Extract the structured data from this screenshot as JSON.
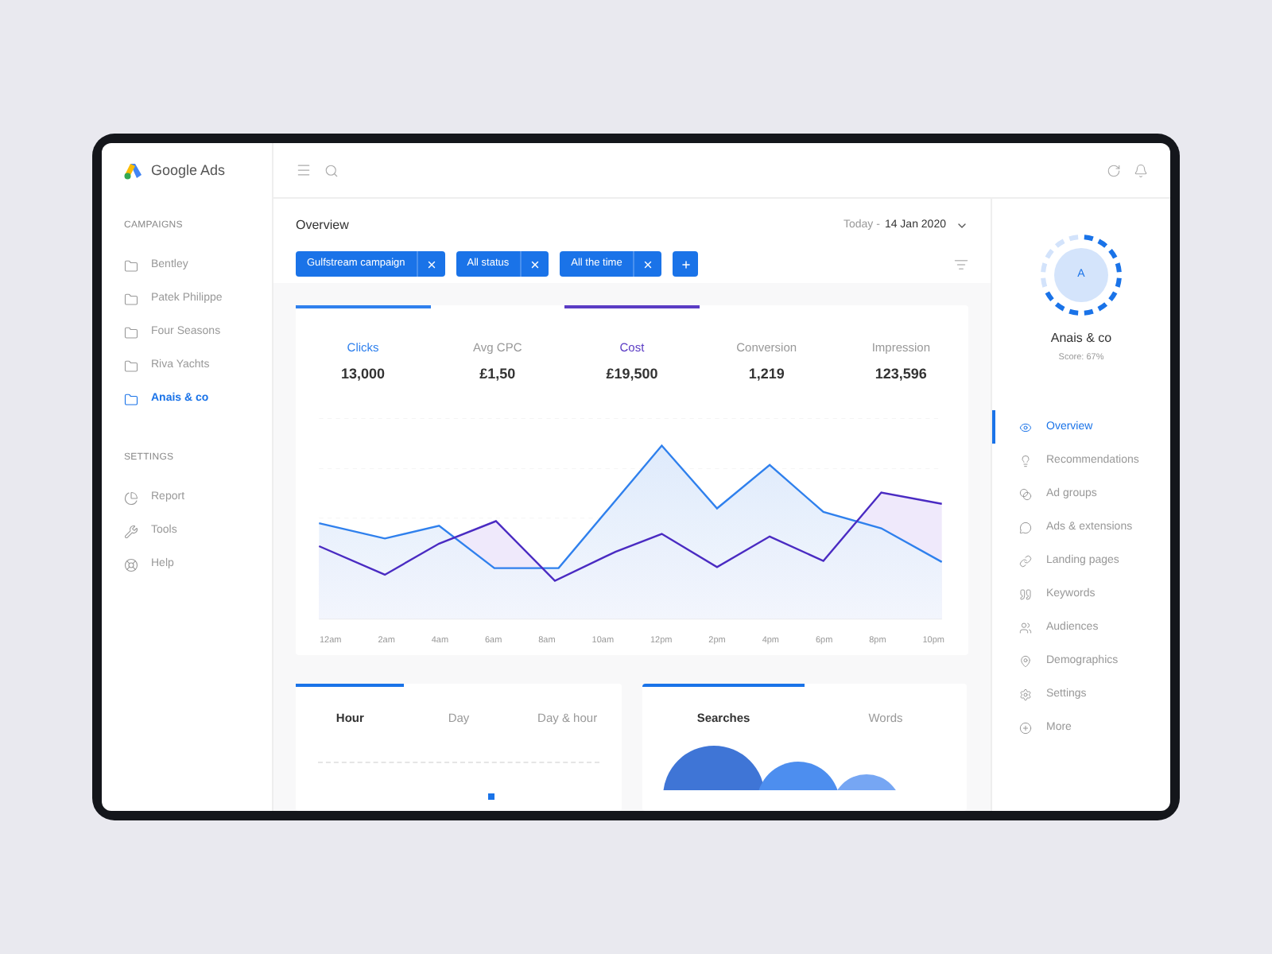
{
  "app": {
    "name": "Google Ads"
  },
  "sidebar": {
    "sections": [
      {
        "title": "CAMPAIGNS",
        "items": [
          {
            "label": "Bentley",
            "selected": false
          },
          {
            "label": "Patek Philippe",
            "selected": false
          },
          {
            "label": "Four Seasons",
            "selected": false
          },
          {
            "label": "Riva Yachts",
            "selected": false
          },
          {
            "label": "Anais & co",
            "selected": true
          }
        ]
      },
      {
        "title": "SETTINGS",
        "items": [
          {
            "label": "Report",
            "selected": false
          },
          {
            "label": "Tools",
            "selected": false
          },
          {
            "label": "Help",
            "selected": false
          }
        ]
      }
    ]
  },
  "header": {
    "title": "Overview",
    "date_prefix": "Today -",
    "date": "14 Jan 2020"
  },
  "filters": [
    {
      "label": "Gulfstream campaign"
    },
    {
      "label": "All status"
    },
    {
      "label": "All the time"
    }
  ],
  "metrics": [
    {
      "label": "Clicks",
      "value": "13,000",
      "selected": true,
      "color": "#2f80ed"
    },
    {
      "label": "Avg CPC",
      "value": "£1,50",
      "selected": false
    },
    {
      "label": "Cost",
      "value": "£19,500",
      "selected": true,
      "color": "#5b3cc4"
    },
    {
      "label": "Conversion",
      "value": "1,219",
      "selected": false
    },
    {
      "label": "Impression",
      "value": "123,596",
      "selected": false
    }
  ],
  "x_labels": [
    "12am",
    "2am",
    "4am",
    "6am",
    "8am",
    "10am",
    "12pm",
    "2pm",
    "4pm",
    "6pm",
    "8pm",
    "10pm"
  ],
  "time_tabs": [
    {
      "label": "Hour",
      "selected": true
    },
    {
      "label": "Day",
      "selected": false
    },
    {
      "label": "Day & hour",
      "selected": false
    }
  ],
  "search_tabs": [
    {
      "label": "Searches",
      "selected": true
    },
    {
      "label": "Words",
      "selected": false
    }
  ],
  "profile": {
    "initial": "A",
    "name": "Anais & co",
    "score": "Score: 67%",
    "level": 0.67
  },
  "nav": [
    {
      "label": "Overview",
      "selected": true
    },
    {
      "label": "Recommendations",
      "selected": false
    },
    {
      "label": "Ad groups",
      "selected": false
    },
    {
      "label": "Ads & extensions",
      "selected": false
    },
    {
      "label": "Landing pages",
      "selected": false
    },
    {
      "label": "Keywords",
      "selected": false
    },
    {
      "label": "Audiences",
      "selected": false
    },
    {
      "label": "Demographics",
      "selected": false
    },
    {
      "label": "Settings",
      "selected": false
    },
    {
      "label": "More",
      "selected": false
    }
  ]
}
